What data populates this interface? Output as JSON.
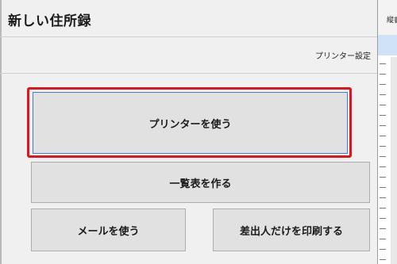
{
  "dialog": {
    "title": "新しい住所録",
    "printer_settings_link": "プリンター設定"
  },
  "buttons": {
    "use_printer": "プリンターを使う",
    "make_list": "一覧表を作る",
    "use_mail": "メールを使う",
    "print_sender_only": "差出人だけを印刷する"
  },
  "background_window": {
    "header_text": "縦書"
  },
  "colors": {
    "highlight": "#e1141e",
    "focus_border": "#3c7fd6",
    "button_bg": "#e1e1e1",
    "dialog_bg": "#f0f0f0"
  }
}
